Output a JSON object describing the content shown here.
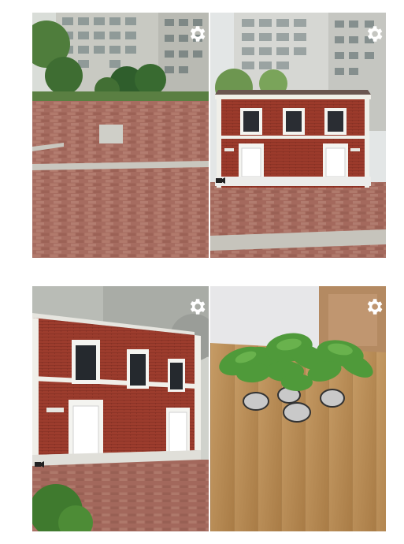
{
  "panels": [
    {
      "id": "p1",
      "scene": "empty-plaza",
      "settings_icon": "gear-icon"
    },
    {
      "id": "p2",
      "scene": "ar-brick-house-front",
      "settings_icon": "gear-icon"
    },
    {
      "id": "p3",
      "scene": "ar-brick-house-angled",
      "settings_icon": "gear-icon"
    },
    {
      "id": "p4",
      "scene": "ar-potted-plants",
      "settings_icon": "gear-icon"
    }
  ],
  "colors": {
    "background": "#ffffff",
    "paving": "#a86a5e",
    "brick": "#9a3b2c",
    "wood_floor": "#b88852",
    "leaf": "#4a9a3a",
    "gear": "#ffffff"
  }
}
